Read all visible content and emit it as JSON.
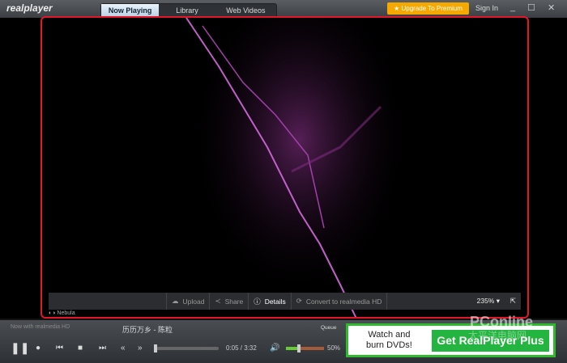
{
  "app": {
    "logo": "realplayer"
  },
  "tabs": [
    {
      "label": "Now Playing"
    },
    {
      "label": "Library"
    },
    {
      "label": "Web Videos"
    }
  ],
  "header": {
    "upgrade": "★ Upgrade To Premium",
    "signin": "Sign In",
    "minimize": "_",
    "maximize": "☐",
    "close": "✕"
  },
  "video_toolbar": {
    "upload": "Upload",
    "share": "Share",
    "details": "Details",
    "convert": "Convert to realmedia HD",
    "zoom": "235%",
    "visualization": "Nebula"
  },
  "player": {
    "now_with": "Now with realmedia HD",
    "song": "历历万乡 - 陈粒",
    "queue": "Queue",
    "time": "0:05 / 3:32",
    "volume": "50%",
    "progress": 0.024,
    "volume_level": 0.5
  },
  "ad": {
    "text_line1": "Watch and",
    "text_line2": "burn DVDs!",
    "button": "Get RealPlayer Plus"
  },
  "watermark": {
    "brand": "PConline",
    "sub": "太平洋电脑网"
  }
}
